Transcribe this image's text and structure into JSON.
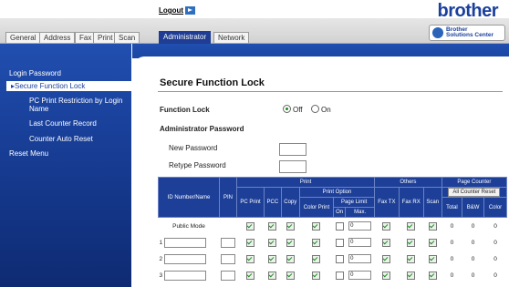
{
  "header": {
    "logout_label": "Logout",
    "brand_name": "brother",
    "solutions_center": [
      "Brother",
      "Solutions Center"
    ]
  },
  "tabs": [
    {
      "label": "General"
    },
    {
      "label": "Address"
    },
    {
      "label": "Fax"
    },
    {
      "label": "Print"
    },
    {
      "label": "Scan"
    },
    {
      "label": "Administrator",
      "active": true
    },
    {
      "label": "Network"
    }
  ],
  "sidebar": {
    "items": [
      {
        "label": "Login Password"
      },
      {
        "label": "Secure Function Lock",
        "selected": true
      },
      {
        "label": "PC Print Restriction by Login Name"
      },
      {
        "label": "Last Counter Record"
      },
      {
        "label": "Counter Auto Reset"
      },
      {
        "label": "Reset Menu"
      }
    ]
  },
  "page": {
    "title": "Secure Function Lock",
    "function_lock_label": "Function Lock",
    "function_lock_options": [
      "Off",
      "On"
    ],
    "function_lock_selected": "Off",
    "admin_password_label": "Administrator Password",
    "new_password_label": "New Password",
    "retype_password_label": "Retype Password"
  },
  "table": {
    "headers": {
      "id": "ID Number/Name",
      "pin": "PIN",
      "print": "Print",
      "others": "Others",
      "page_counter": "Page Counter",
      "all_counter_reset": "All Counter Reset",
      "pc_print": "PC Print",
      "pcc": "PCC",
      "copy": "Copy",
      "print_option": "Print Option",
      "color_print": "Color Print",
      "page_limit": "Page Limit",
      "on": "On",
      "max": "Max.",
      "fax_tx": "Fax TX",
      "fax_rx": "Fax RX",
      "scan": "Scan",
      "total": "Total",
      "bw": "B&W",
      "color": "Color"
    },
    "rows": [
      {
        "num": "",
        "name": "Public Mode",
        "max": "0",
        "total": "0",
        "bw": "0",
        "color": "0"
      },
      {
        "num": "1",
        "name": "",
        "max": "0",
        "total": "0",
        "bw": "0",
        "color": "0"
      },
      {
        "num": "2",
        "name": "",
        "max": "0",
        "total": "0",
        "bw": "0",
        "color": "0"
      },
      {
        "num": "3",
        "name": "",
        "max": "0",
        "total": "0",
        "bw": "0",
        "color": "0"
      }
    ]
  }
}
